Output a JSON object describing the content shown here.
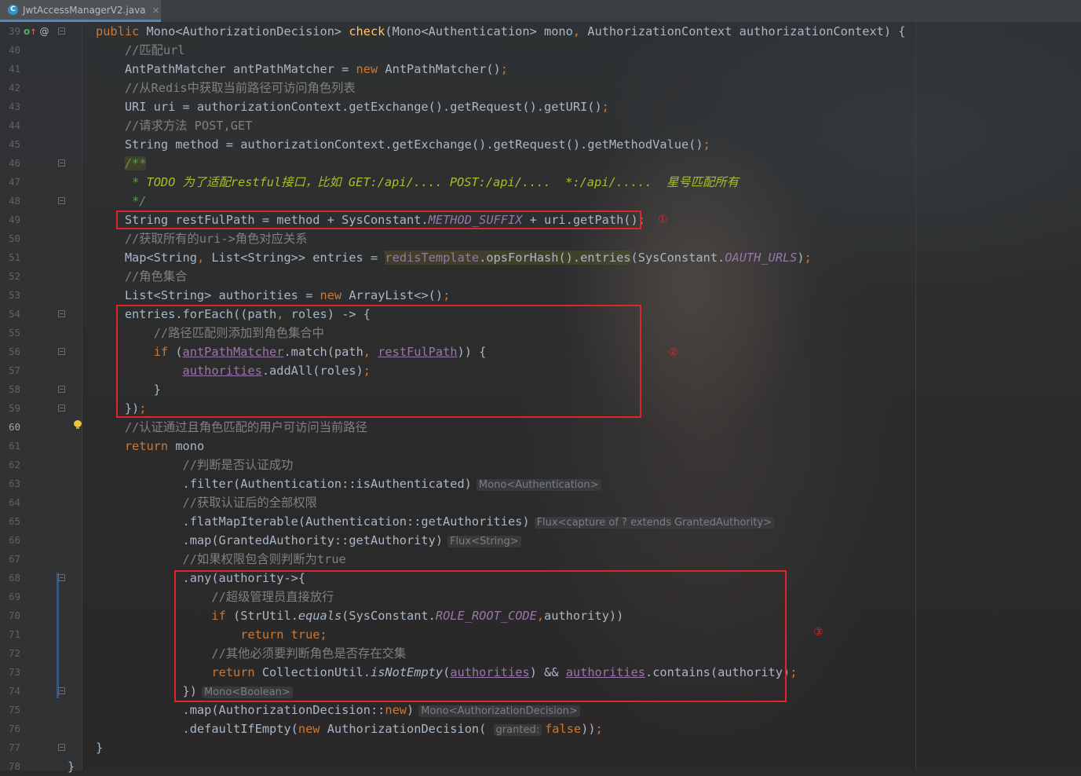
{
  "tab": {
    "icon": "java-class-icon",
    "icon_glyph": "C",
    "title": "JwtAccessManagerV2.java",
    "close": "×"
  },
  "gutter_icons": {
    "override": "o",
    "arrow": "↑",
    "at": "@"
  },
  "lines": [
    {
      "n": "39",
      "fold": true,
      "html": "<span class=\"k\">public</span> Mono&lt;AuthorizationDecision&gt; <span class=\"fn\">check</span>(Mono&lt;Authentication&gt; mono<span class=\"k\">,</span> AuthorizationContext authorizationContext) {"
    },
    {
      "n": "40",
      "html": "    <span class=\"cm\">//匹配url</span>"
    },
    {
      "n": "41",
      "html": "    AntPathMatcher antPathMatcher = <span class=\"k\">new</span> AntPathMatcher()<span class=\"k\">;</span>"
    },
    {
      "n": "42",
      "html": "    <span class=\"cm\">//从Redis中获取当前路径可访问角色列表</span>"
    },
    {
      "n": "43",
      "html": "    URI uri = authorizationContext.getExchange().getRequest().getURI()<span class=\"k\">;</span>"
    },
    {
      "n": "44",
      "html": "    <span class=\"cm\">//请求方法 POST,GET</span>"
    },
    {
      "n": "45",
      "html": "    String method = authorizationContext.getExchange().getRequest().getMethodValue()<span class=\"k\">;</span>"
    },
    {
      "n": "46",
      "fold": true,
      "html": "    <span class=\"dc hl\">/**</span>"
    },
    {
      "n": "47",
      "html": "     <span class=\"dc\">*</span> <span class=\"todo\">TODO 为了适配restful接口，比如 GET:/api/.... POST:/api/....  *:/api/.....  星号匹配所有</span>"
    },
    {
      "n": "48",
      "fold": true,
      "html": "     <span class=\"dc\">*/</span>"
    },
    {
      "n": "49",
      "html": "    String restFulPath = method + SysConstant.<span class=\"cst\">METHOD_SUFFIX</span> + uri.getPath()<span class=\"k\">;</span>"
    },
    {
      "n": "50",
      "html": "    <span class=\"cm\">//获取所有的uri-&gt;角色对应关系</span>"
    },
    {
      "n": "51",
      "html": "    Map&lt;String<span class=\"k\">,</span> List&lt;String&gt;&gt; entries = <span class=\"hl\"><span class=\"cst\" style=\"font-style:normal\">redisTemplate</span>.opsForHash().entries</span>(SysConstant.<span class=\"cst\">OAUTH_URLS</span>)<span class=\"k\">;</span>"
    },
    {
      "n": "52",
      "html": "    <span class=\"cm\">//角色集合</span>"
    },
    {
      "n": "53",
      "html": "    List&lt;String&gt; authorities = <span class=\"k\">new</span> ArrayList&lt;&gt;()<span class=\"k\">;</span>"
    },
    {
      "n": "54",
      "fold": true,
      "html": "    entries.forEach((path<span class=\"k\">,</span> roles) -&gt; {"
    },
    {
      "n": "55",
      "html": "        <span class=\"cm\">//路径匹配则添加到角色集合中</span>"
    },
    {
      "n": "56",
      "fold": true,
      "html": "        <span class=\"k\">if</span> (<span class=\"fld\">antPathMatcher</span>.match(path<span class=\"k\">,</span> <span class=\"fld\">restFulPath</span>)) {"
    },
    {
      "n": "57",
      "html": "            <span class=\"fld\">authorities</span>.addAll(roles)<span class=\"k\">;</span>"
    },
    {
      "n": "58",
      "fold": true,
      "html": "        }"
    },
    {
      "n": "59",
      "fold": true,
      "html": "    })<span class=\"k\">;</span>"
    },
    {
      "n": "60",
      "cur": true,
      "html": "    <span class=\"cm\">//认证通过且角色匹配的用户可访问当前路径</span>"
    },
    {
      "n": "61",
      "html": "    <span class=\"k\">return</span> mono"
    },
    {
      "n": "62",
      "html": "            <span class=\"cm\">//判断是否认证成功</span>"
    },
    {
      "n": "63",
      "html": "            .filter(Authentication::isAuthenticated)<span class=\"hint\">Mono&lt;Authentication&gt;</span>"
    },
    {
      "n": "64",
      "html": "            <span class=\"cm\">//获取认证后的全部权限</span>"
    },
    {
      "n": "65",
      "html": "            .flatMapIterable(Authentication::getAuthorities)<span class=\"hint\">Flux&lt;capture of ? extends GrantedAuthority&gt;</span>"
    },
    {
      "n": "66",
      "html": "            .map(GrantedAuthority::getAuthority)<span class=\"hint\">Flux&lt;String&gt;</span>"
    },
    {
      "n": "67",
      "html": "            <span class=\"cm\">//如果权限包含则判断为true</span>"
    },
    {
      "n": "68",
      "fold": true,
      "html": "            .any(authority-&gt;{"
    },
    {
      "n": "69",
      "html": "                <span class=\"cm\">//超级管理员直接放行</span>"
    },
    {
      "n": "70",
      "html": "                <span class=\"k\">if</span> (StrUtil.<span class=\"st\">equals</span>(SysConstant.<span class=\"cst\">ROLE_ROOT_CODE</span><span class=\"k\">,</span>authority))"
    },
    {
      "n": "71",
      "html": "                    <span class=\"k\">return true;</span>"
    },
    {
      "n": "72",
      "html": "                <span class=\"cm\">//其他必须要判断角色是否存在交集</span>"
    },
    {
      "n": "73",
      "html": "                <span class=\"k\">return</span> CollectionUtil.<span class=\"st\">isNotEmpty</span>(<span class=\"fld\">authorities</span>) &amp;&amp; <span class=\"fld\">authorities</span>.contains(authority)<span class=\"k\">;</span>"
    },
    {
      "n": "74",
      "fold": true,
      "html": "            })<span class=\"hint\">Mono&lt;Boolean&gt;</span>"
    },
    {
      "n": "75",
      "html": "            .map(AuthorizationDecision::<span class=\"k\">new</span>)<span class=\"hint\">Mono&lt;AuthorizationDecision&gt;</span>"
    },
    {
      "n": "76",
      "html": "            .defaultIfEmpty(<span class=\"k\">new</span> AuthorizationDecision( <span class=\"hint param\">granted:</span><span class=\"k\">false</span>))<span class=\"k\">;</span>"
    },
    {
      "n": "77",
      "fold": true,
      "html": "}"
    },
    {
      "n": "78",
      "html": "<span style=\"margin-left:-36px\">}</span>"
    }
  ],
  "annotations": [
    {
      "label": "①"
    },
    {
      "label": "②"
    },
    {
      "label": "③"
    }
  ]
}
